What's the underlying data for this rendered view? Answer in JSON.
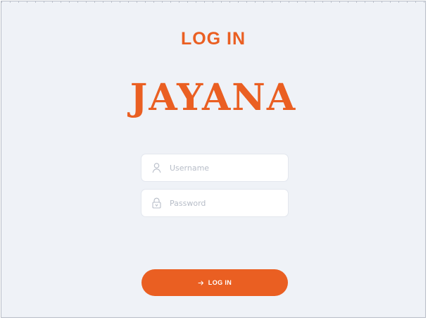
{
  "header": {
    "title": "LOG IN",
    "brand": "JAYANA"
  },
  "form": {
    "username": {
      "placeholder": "Username",
      "value": "",
      "icon": "user-icon"
    },
    "password": {
      "placeholder": "Password",
      "value": "",
      "icon": "lock-icon"
    },
    "submit": {
      "label": "LOG IN",
      "icon": "arrow-right-icon"
    }
  },
  "colors": {
    "accent": "#ea5f22",
    "background": "#eff2f7",
    "field_background": "#ffffff",
    "icon": "#b7bdc8"
  }
}
